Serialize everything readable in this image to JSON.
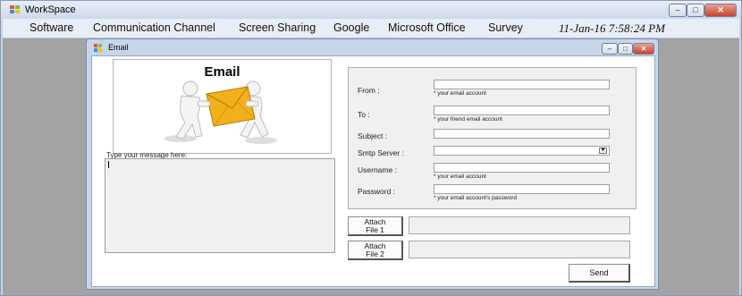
{
  "window": {
    "title": "WorkSpace"
  },
  "menu": {
    "items": [
      "Software",
      "Communication Channel",
      "Screen Sharing",
      "Google",
      "Microsoft Office",
      "Survey"
    ],
    "datetime": "11-Jan-16 7:58:24 PM"
  },
  "email_window": {
    "title": "Email",
    "image_title": "Email",
    "message_label": "Type your message here:",
    "message_value": "",
    "form": {
      "from_label": "From :",
      "from_value": "",
      "from_hint": "* your email account",
      "to_label": "To :",
      "to_value": "",
      "to_hint": "* your friend email account",
      "subject_label": "Subject :",
      "subject_value": "",
      "smtp_label": "Smtp Server :",
      "smtp_value": "",
      "username_label": "Username :",
      "username_value": "",
      "username_hint": "* your email account",
      "password_label": "Password :",
      "password_value": "",
      "password_hint": "* your email account's password"
    },
    "attach1": {
      "line1": "Attach",
      "line2": "File 1",
      "path": ""
    },
    "attach2": {
      "line1": "Attach",
      "line2": "File 2",
      "path": ""
    },
    "send_label": "Send"
  },
  "colors": {
    "envelope": "#f2b11a",
    "titlebar": "#cdd8ea",
    "close_button": "#c7442f",
    "workspace_background": "#a3a3a3"
  },
  "icons": [
    "app-icon",
    "minimize-icon",
    "maximize-icon",
    "close-icon",
    "chevron-down-icon"
  ]
}
